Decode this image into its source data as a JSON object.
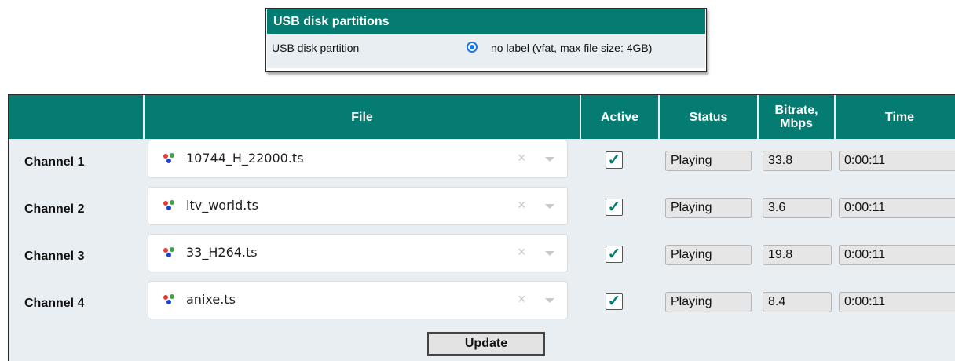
{
  "usb": {
    "title": "USB disk partitions",
    "row_label": "USB disk partition",
    "partition_value": "no label (vfat, max file size: 4GB)"
  },
  "table": {
    "headers": {
      "file": "File",
      "active": "Active",
      "status": "Status",
      "bitrate_line1": "Bitrate,",
      "bitrate_line2": "Mbps",
      "time": "Time"
    },
    "channels": [
      {
        "label": "Channel 1",
        "file": "10744_H_22000.ts",
        "active": true,
        "status": "Playing",
        "bitrate": "33.8",
        "time": "0:00:11"
      },
      {
        "label": "Channel 2",
        "file": "ltv_world.ts",
        "active": true,
        "status": "Playing",
        "bitrate": "3.6",
        "time": "0:00:11"
      },
      {
        "label": "Channel 3",
        "file": "33_H264.ts",
        "active": true,
        "status": "Playing",
        "bitrate": "19.8",
        "time": "0:00:11"
      },
      {
        "label": "Channel 4",
        "file": "anixe.ts",
        "active": true,
        "status": "Playing",
        "bitrate": "8.4",
        "time": "0:00:11"
      }
    ],
    "clear_glyph": "×",
    "check_glyph": "✓",
    "update_label": "Update"
  },
  "colors": {
    "header_bg": "#047c72",
    "row_bg": "#e8eef1",
    "radio": "#1a73e8"
  },
  "icons": {
    "file": "rgb-dots-icon",
    "clear": "clear-icon",
    "dropdown": "chevron-down-icon"
  }
}
